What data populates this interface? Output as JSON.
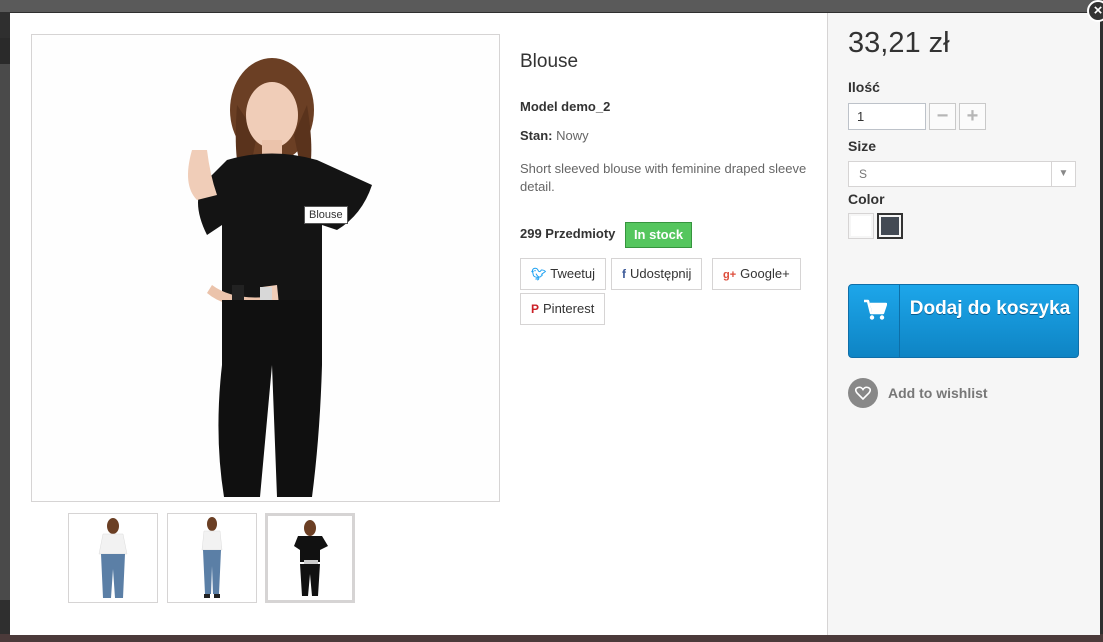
{
  "modal": {
    "close_label": "×"
  },
  "gallery": {
    "main_image_label": "Blouse",
    "thumbnails": [
      {
        "alt": "white blouse front",
        "shirt_color": "#f2f2f2",
        "active": false
      },
      {
        "alt": "white blouse full",
        "shirt_color": "#f2f2f2",
        "active": false
      },
      {
        "alt": "black blouse",
        "shirt_color": "#111111",
        "active": true
      }
    ]
  },
  "product": {
    "name": "Blouse",
    "model": "Model demo_2",
    "condition_label": "Stan:",
    "condition_value": "Nowy",
    "description": "Short sleeved blouse with feminine draped sleeve detail.",
    "quantity_text": "299 Przedmioty",
    "stock_status": "In stock",
    "stock_color": "#55c65e"
  },
  "social": {
    "tweet": "Tweetuj",
    "facebook": "Udostępnij",
    "google": "Google+",
    "pinterest": "Pinterest",
    "tweet_icon": "twitter-icon",
    "facebook_icon": "facebook-icon",
    "google_icon": "google-plus-icon",
    "pinterest_icon": "pinterest-icon"
  },
  "purchase": {
    "price": "33,21 zł",
    "quantity_label": "Ilość",
    "quantity_value": "1",
    "minus": "−",
    "plus": "+",
    "size_label": "Size",
    "size_value": "S",
    "color_label": "Color",
    "colors": [
      {
        "name": "White",
        "hex": "#ffffff",
        "selected": false
      },
      {
        "name": "Black",
        "hex": "#434a54",
        "selected": true
      }
    ],
    "add_to_cart": "Dodaj do koszyka",
    "add_to_cart_color": "#1b90d4",
    "wishlist": "Add to wishlist"
  }
}
